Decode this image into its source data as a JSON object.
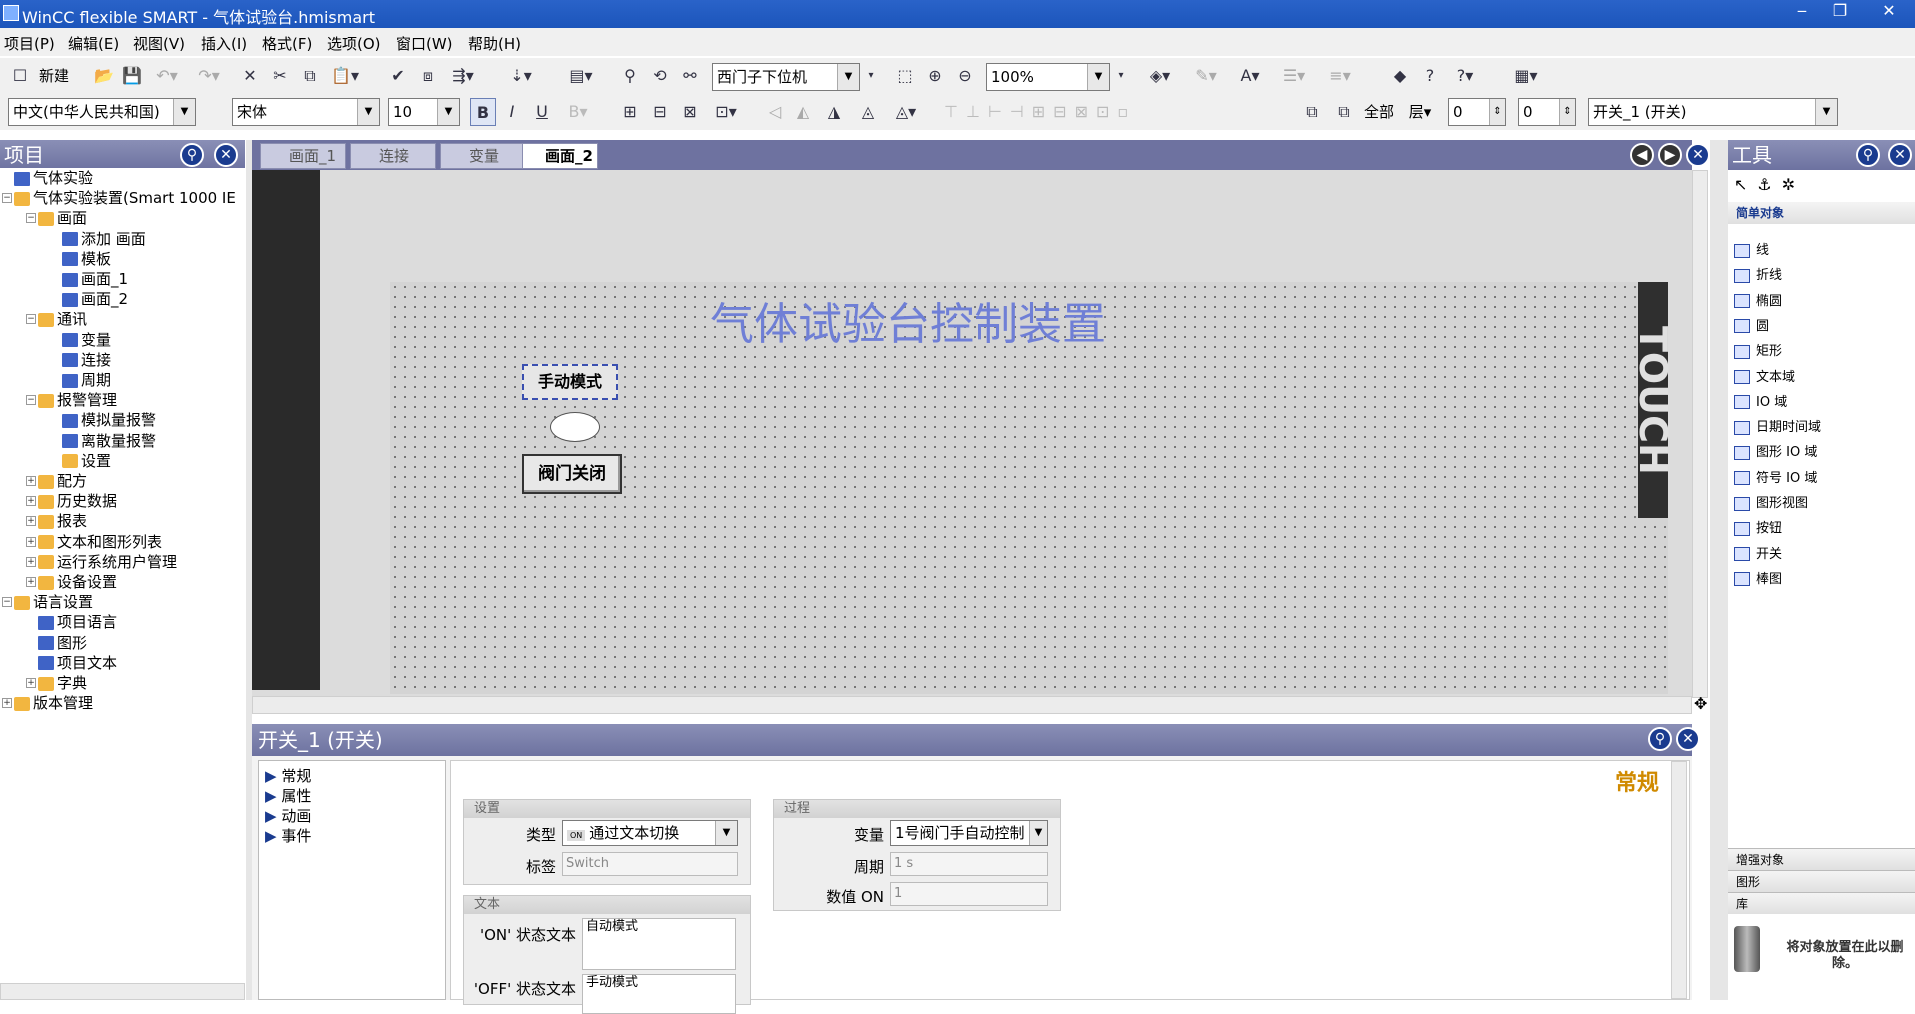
{
  "window": {
    "title": "WinCC flexible SMART - 气体试验台.hmismart"
  },
  "menu": [
    "项目(P)",
    "编辑(E)",
    "视图(V)",
    "插入(I)",
    "格式(F)",
    "选项(O)",
    "窗口(W)",
    "帮助(H)"
  ],
  "toolbar1": {
    "new_label": "新建",
    "device_combo": "西门子下位机",
    "zoom_combo": "100%"
  },
  "toolbar2": {
    "lang_combo": "中文(中华人民共和国)",
    "font_combo": "宋体",
    "size_combo": "10",
    "all_label": "全部",
    "layer_label": "层",
    "num1": "0",
    "num2": "0",
    "object_combo": "开关_1 (开关)"
  },
  "project_panel": {
    "title": "项目",
    "tree": [
      {
        "label": "气体实验",
        "level": 0
      },
      {
        "label": "气体实验装置(Smart 1000 IE",
        "level": 0
      },
      {
        "label": "画面",
        "level": 1
      },
      {
        "label": "添加 画面",
        "level": 2
      },
      {
        "label": "模板",
        "level": 2
      },
      {
        "label": "画面_1",
        "level": 2
      },
      {
        "label": "画面_2",
        "level": 2
      },
      {
        "label": "通讯",
        "level": 1
      },
      {
        "label": "变量",
        "level": 2
      },
      {
        "label": "连接",
        "level": 2
      },
      {
        "label": "周期",
        "level": 2
      },
      {
        "label": "报警管理",
        "level": 1
      },
      {
        "label": "模拟量报警",
        "level": 2
      },
      {
        "label": "离散量报警",
        "level": 2
      },
      {
        "label": "设置",
        "level": 2
      },
      {
        "label": "配方",
        "level": 1
      },
      {
        "label": "历史数据",
        "level": 1
      },
      {
        "label": "报表",
        "level": 1
      },
      {
        "label": "文本和图形列表",
        "level": 1
      },
      {
        "label": "运行系统用户管理",
        "level": 1
      },
      {
        "label": "设备设置",
        "level": 1
      },
      {
        "label": "语言设置",
        "level": 0
      },
      {
        "label": "项目语言",
        "level": 1
      },
      {
        "label": "图形",
        "level": 1
      },
      {
        "label": "项目文本",
        "level": 1
      },
      {
        "label": "字典",
        "level": 1
      },
      {
        "label": "版本管理",
        "level": 0
      }
    ]
  },
  "editor_tabs": [
    "画面_1",
    "连接",
    "变量",
    "画面_2"
  ],
  "screen": {
    "heading": "气体试验台控制装置",
    "btn_manual": "手动模式",
    "btn_valve": "阀门关闭",
    "side_text": "TOUCH"
  },
  "properties": {
    "title": "开关_1 (开关)",
    "nav": [
      "常规",
      "属性",
      "动画",
      "事件"
    ],
    "section_title": "常规",
    "settings_group": "设置",
    "type_label": "类型",
    "type_value": "通过文本切换",
    "type_badge": "ON",
    "tag_label": "标签",
    "tag_value": "Switch",
    "text_group": "文本",
    "on_label": "'ON' 状态文本",
    "on_value": "自动模式",
    "off_label": "'OFF' 状态文本",
    "off_value": "手动模式",
    "process_group": "过程",
    "var_label": "变量",
    "var_value": "1号阀门手自动控制",
    "cycle_label": "周期",
    "cycle_value": "1 s",
    "on_value_label": "数值 ON",
    "on_value_value": "1"
  },
  "tools_panel": {
    "title": "工具",
    "simple_objects": "简单对象",
    "items": [
      "线",
      "折线",
      "椭圆",
      "圆",
      "矩形",
      "文本域",
      "IO 域",
      "日期时间域",
      "图形 IO 域",
      "符号 IO 域",
      "图形视图",
      "按钮",
      "开关",
      "棒图"
    ],
    "enhanced_objects": "增强对象",
    "graphics": "图形",
    "library": "库",
    "drop_hint": "将对象放置在此以删除。"
  },
  "colors": {
    "title_bar": "#1c55bb",
    "panel_header": "#6d72a0",
    "heading_text": "#6f7fd6",
    "accent": "#d08a00"
  }
}
